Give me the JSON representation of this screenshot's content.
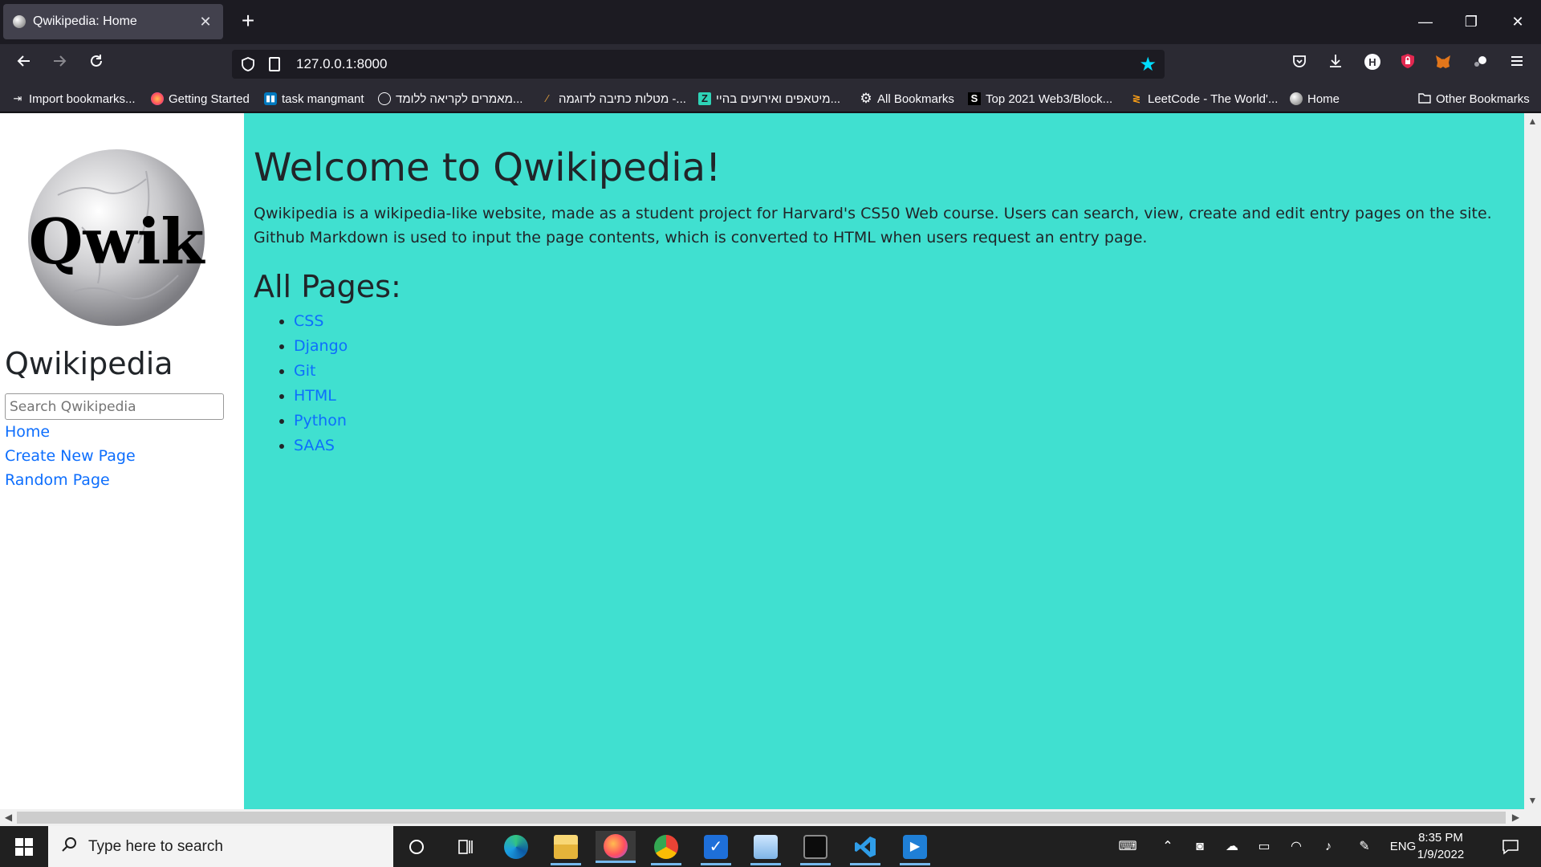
{
  "browser": {
    "tab_title": "Qwikipedia: Home",
    "tab_close": "✕",
    "new_tab": "+",
    "url": "127.0.0.1:8000",
    "window_controls": {
      "minimize": "—",
      "restore": "❐",
      "close": "✕"
    },
    "bookmarks": [
      {
        "label": "Import bookmarks...",
        "icon": "import-icon"
      },
      {
        "label": "Getting Started",
        "icon": "firefox-icon"
      },
      {
        "label": "task mangmant",
        "icon": "trello-icon"
      },
      {
        "label": "מאמרים לקריאה ללומד...",
        "icon": "globe-icon"
      },
      {
        "label": "מטלות כתיבה לדוגמה -...",
        "icon": "feather-icon"
      },
      {
        "label": "מיטאפים ואירועים בהיי...",
        "icon": "z-icon"
      },
      {
        "label": "All Bookmarks",
        "icon": "gear-icon"
      },
      {
        "label": "Top 2021 Web3/Block...",
        "icon": "s-icon"
      },
      {
        "label": "LeetCode - The World'...",
        "icon": "leetcode-icon"
      },
      {
        "label": "Home",
        "icon": "qwik-icon"
      }
    ],
    "other_bookmarks": "Other Bookmarks"
  },
  "sidebar": {
    "logo_text": "Qwik",
    "site_title": "Qwikipedia",
    "search_placeholder": "Search Qwikipedia",
    "links": {
      "home": "Home",
      "create": "Create New Page",
      "random": "Random Page"
    }
  },
  "main": {
    "heading": "Welcome to Qwikipedia!",
    "intro": "Qwikipedia is a wikipedia-like website, made as a student project for Harvard's CS50 Web course. Users can search, view, create and edit entry pages on the site. Github Markdown is used to input the page contents, which is converted to HTML when users request an entry page.",
    "pages_heading": "All Pages:",
    "pages": [
      "CSS",
      "Django",
      "Git",
      "HTML",
      "Python",
      "SAAS"
    ]
  },
  "taskbar": {
    "search_placeholder": "Type here to search",
    "language": "ENG",
    "time": "8:35 PM",
    "date": "1/9/2022"
  },
  "colors": {
    "content_bg": "#40e0d0",
    "link": "#0d6efd",
    "bookmark_star": "#00ddff"
  }
}
